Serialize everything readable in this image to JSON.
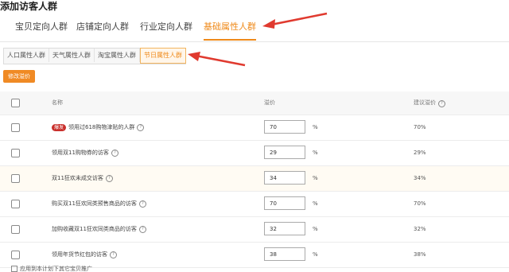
{
  "page": {
    "title": "添加访客人群"
  },
  "tabs": [
    {
      "label": "宝贝定向人群"
    },
    {
      "label": "店铺定向人群"
    },
    {
      "label": "行业定向人群"
    },
    {
      "label": "基础属性人群"
    }
  ],
  "subtabs": [
    {
      "label": "人口属性人群"
    },
    {
      "label": "天气属性人群"
    },
    {
      "label": "淘宝属性人群"
    },
    {
      "label": "节日属性人群"
    }
  ],
  "toolbar": {
    "bid_button": "修改溢价"
  },
  "table": {
    "headers": {
      "name": "名称",
      "bid": "溢价",
      "suggest": "建议溢价"
    },
    "rows": [
      {
        "tag": "爆发",
        "name": "领用过618购物津贴的人群",
        "bid": "70",
        "unit": "%",
        "suggest": "70%"
      },
      {
        "tag": "",
        "name": "领用双11购物券的访客",
        "bid": "29",
        "unit": "%",
        "suggest": "29%"
      },
      {
        "tag": "",
        "name": "双11狂欢未成交访客",
        "bid": "34",
        "unit": "%",
        "suggest": "34%"
      },
      {
        "tag": "",
        "name": "购买双11狂欢同类预售商品的访客",
        "bid": "70",
        "unit": "%",
        "suggest": "70%"
      },
      {
        "tag": "",
        "name": "加购收藏双11狂欢同类商品的访客",
        "bid": "32",
        "unit": "%",
        "suggest": "32%"
      },
      {
        "tag": "",
        "name": "领用年货节红包的访客",
        "bid": "38",
        "unit": "%",
        "suggest": "38%"
      }
    ]
  },
  "footer": {
    "text": "应用到本计划下其它宝贝推广"
  },
  "colors": {
    "accent": "#ef8a1a",
    "arrow": "#e03a2f",
    "tag": "#c9302c"
  }
}
